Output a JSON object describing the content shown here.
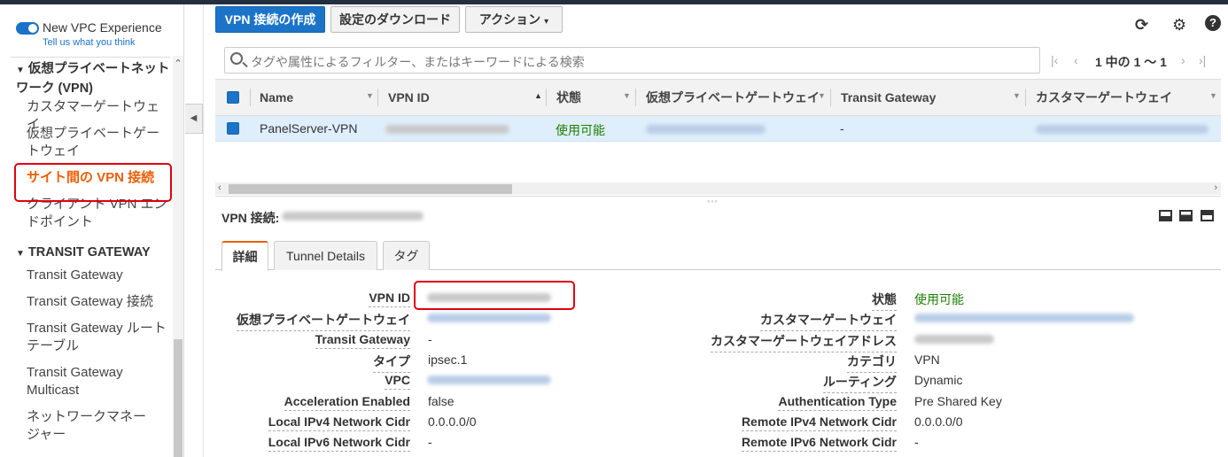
{
  "sidebar": {
    "toggle_label": "New VPC Experience",
    "tell_link": "Tell us what you think",
    "section_vpn": "仮想プライベートネットワーク (VPN)",
    "vpn_items": [
      "カスタマーゲートウェイ",
      "仮想プライベートゲートウェイ",
      "サイト間の VPN 接続",
      "クライアント VPN エンドポイント"
    ],
    "section_tgw": "TRANSIT GATEWAY",
    "tgw_items": [
      "Transit Gateway",
      "Transit Gateway 接続",
      "Transit Gateway ルートテーブル",
      "Transit Gateway Multicast",
      "ネットワークマネージャー"
    ]
  },
  "toolbar": {
    "create_label": "VPN 接続の作成",
    "download_label": "設定のダウンロード",
    "actions_label": "アクション"
  },
  "search": {
    "placeholder": "タグや属性によるフィルター、またはキーワードによる検索"
  },
  "pager": {
    "text": "1 中の 1 〜 1"
  },
  "table": {
    "columns": [
      "Name",
      "VPN ID",
      "状態",
      "仮想プライベートゲートウェイ",
      "Transit Gateway",
      "カスタマーゲートウェイ"
    ],
    "row": {
      "name": "PanelServer-VPN",
      "state": "使用可能",
      "tgw": "-"
    }
  },
  "detail": {
    "title": "VPN 接続:",
    "tabs": [
      "詳細",
      "Tunnel Details",
      "タグ"
    ],
    "left": [
      {
        "label": "VPN ID",
        "value": ""
      },
      {
        "label": "仮想プライベートゲートウェイ",
        "value": ""
      },
      {
        "label": "Transit Gateway",
        "value": "-"
      },
      {
        "label": "タイプ",
        "value": "ipsec.1"
      },
      {
        "label": "VPC",
        "value": ""
      },
      {
        "label": "Acceleration Enabled",
        "value": "false"
      },
      {
        "label": "Local IPv4 Network Cidr",
        "value": "0.0.0.0/0"
      },
      {
        "label": "Local IPv6 Network Cidr",
        "value": "-"
      }
    ],
    "right": [
      {
        "label": "状態",
        "value": "使用可能"
      },
      {
        "label": "カスタマーゲートウェイ",
        "value": ""
      },
      {
        "label": "カスタマーゲートウェイアドレス",
        "value": ""
      },
      {
        "label": "カテゴリ",
        "value": "VPN"
      },
      {
        "label": "ルーティング",
        "value": "Dynamic"
      },
      {
        "label": "Authentication Type",
        "value": "Pre Shared Key"
      },
      {
        "label": "Remote IPv4 Network Cidr",
        "value": "0.0.0.0/0"
      },
      {
        "label": "Remote IPv6 Network Cidr",
        "value": "-"
      }
    ]
  },
  "colors": {
    "primary": "#1c74c8",
    "accent": "#eb5f07",
    "success": "#1d8102",
    "highlight": "#e0000f"
  }
}
